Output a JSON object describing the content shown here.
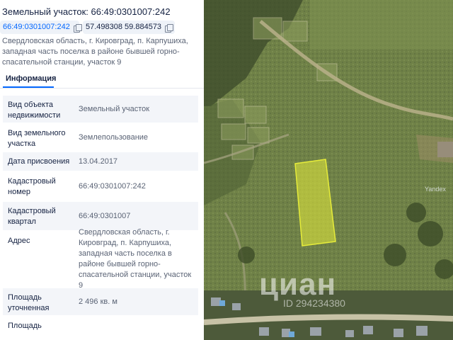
{
  "header": {
    "title": "Земельный участок: 66:49:0301007:242",
    "cadastral_chip": "66:49:0301007:242",
    "coords_chip": "57.498308 59.884573",
    "address": "Свердловская область, г. Кировград, п. Карпушиха, западная часть поселка в районе бывшей горно-спасательной станции, участок 9"
  },
  "tabs": [
    {
      "label": "Информация",
      "active": true
    }
  ],
  "info_rows": [
    {
      "label": "Вид объекта недвижимости",
      "value": "Земельный участок"
    },
    {
      "label": "Вид земельного участка",
      "value": "Землепользование"
    },
    {
      "label": "Дата присвоения",
      "value": "13.04.2017"
    },
    {
      "label": "Кадастровый номер",
      "value": "66:49:0301007:242"
    },
    {
      "label": "Кадастровый квартал",
      "value": "66:49:0301007"
    },
    {
      "label": "Адрес",
      "value": "Свердловская область, г. Кировград, п. Карпушиха, западная часть поселка в районе бывшей горно-спасательной станции, участок 9"
    },
    {
      "label": "Площадь уточненная",
      "value": "2 496 кв. м"
    },
    {
      "label": "Площадь",
      "value": ""
    }
  ],
  "map": {
    "provider_label": "Yandex",
    "watermark_logo": "циан",
    "watermark_id": "ID 294234380",
    "parcel_color": "#e6ec3a"
  },
  "icons": {
    "copy": "copy-icon"
  }
}
